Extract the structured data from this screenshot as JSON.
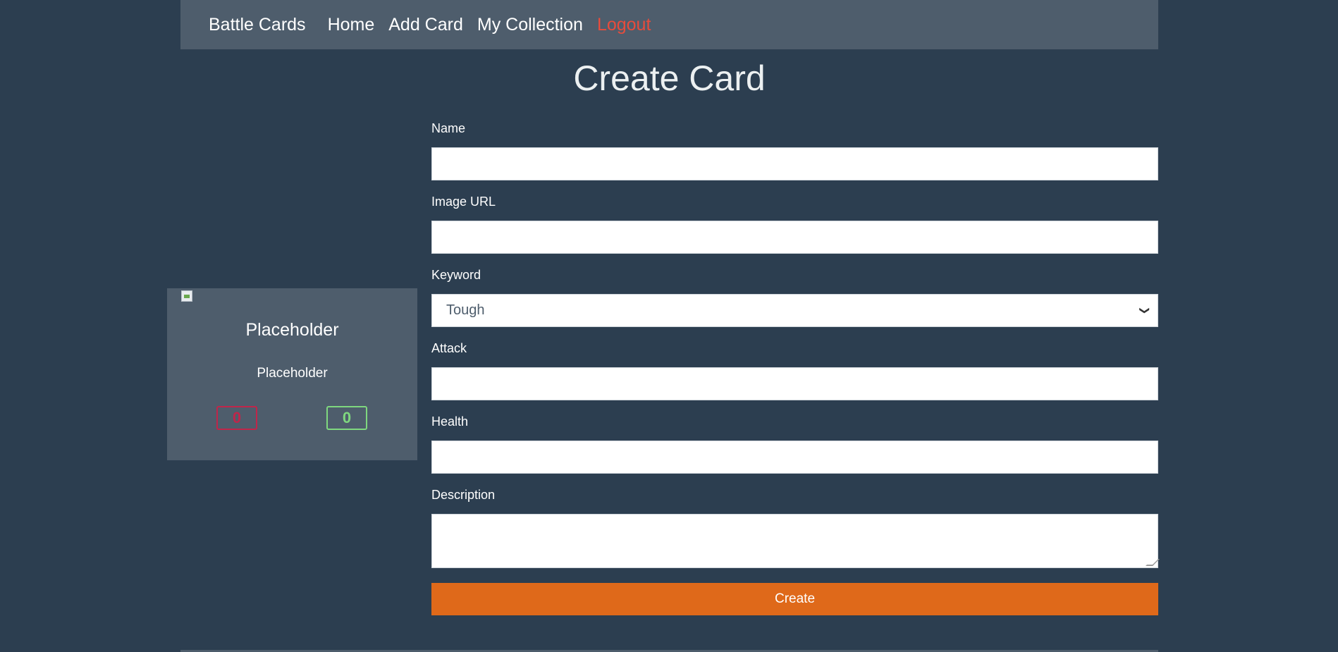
{
  "nav": {
    "brand": "Battle Cards",
    "links": [
      "Home",
      "Add Card",
      "My Collection",
      "Logout"
    ]
  },
  "page": {
    "title": "Create Card"
  },
  "preview": {
    "name": "Placeholder",
    "keyword": "Placeholder",
    "attack": "0",
    "health": "0"
  },
  "form": {
    "name_label": "Name",
    "image_label": "Image URL",
    "keyword_label": "Keyword",
    "keyword_value": "Tough",
    "attack_label": "Attack",
    "health_label": "Health",
    "description_label": "Description",
    "submit_label": "Create"
  },
  "colors": {
    "background": "#2c3e50",
    "navbar": "#4e5d6c",
    "accent": "#df691a",
    "logout": "#e74c3c",
    "attack": "#c0254a",
    "health": "#7fd87f"
  }
}
